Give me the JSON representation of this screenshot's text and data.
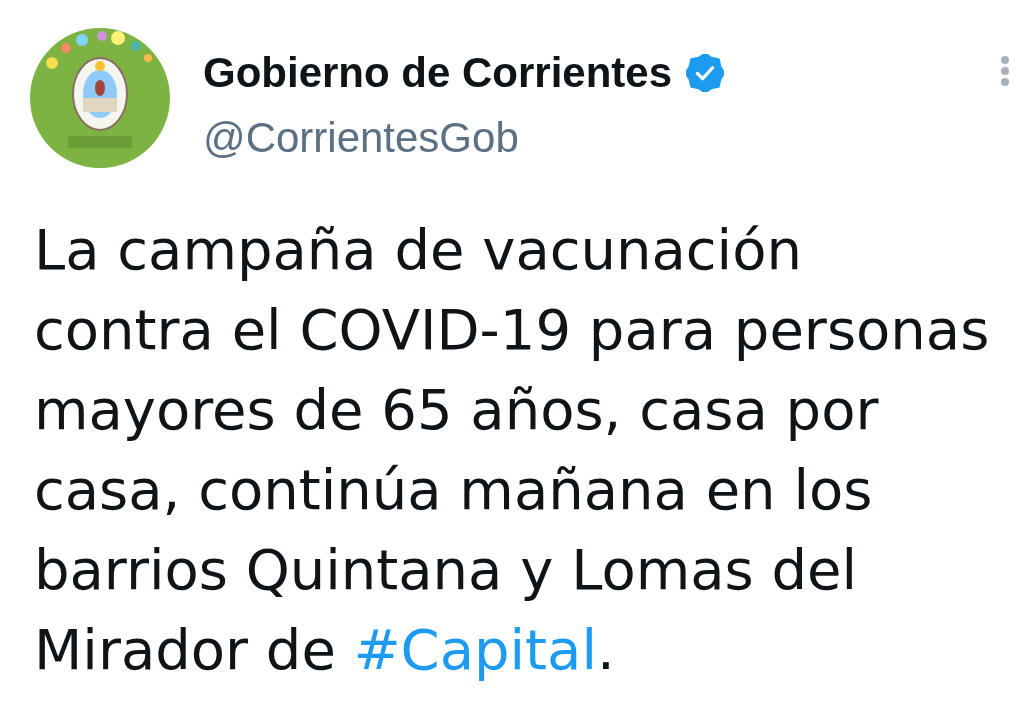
{
  "tweet": {
    "author": {
      "name": "Gobierno de Corrientes",
      "handle": "@CorrientesGob",
      "verified": true
    },
    "text": [
      {
        "kind": "plain",
        "text": "La campaña de vacunación contra el COVID-19 para personas mayores de 65 años, casa por casa, continúa mañana en los barrios Quintana y Lomas del Mirador de "
      },
      {
        "kind": "hashtag",
        "text": "#Capital"
      },
      {
        "kind": "plain",
        "text": "."
      }
    ]
  }
}
